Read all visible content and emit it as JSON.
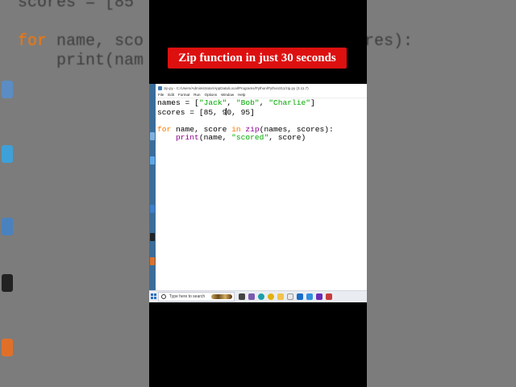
{
  "video": {
    "title": "Zip function in just 30 seconds"
  },
  "background_code": {
    "line1": "scores = [85",
    "line2": "for name, sco",
    "line2b": "ores):",
    "line3": "    print(nam"
  },
  "editor": {
    "window_title": "zip.py - C:/Users/Administrator/AppData/Local/Programs/Python/Python311/zip.py (3.11.7)",
    "menu": [
      "File",
      "Edit",
      "Format",
      "Run",
      "Options",
      "Window",
      "Help"
    ],
    "code_lines": [
      "names = [\"Jack\", \"Bob\", \"Charlie\"]",
      "scores = [85, 90, 95]",
      "",
      "for name, score in zip(names, scores):",
      "    print(name, \"scored\", score)"
    ]
  },
  "taskbar": {
    "search_placeholder": "Type here to search",
    "icons": [
      "task-view",
      "widgets",
      "edge",
      "chrome",
      "file-explorer",
      "store",
      "mail",
      "vs-code",
      "visual-studio",
      "app"
    ]
  },
  "colors": {
    "banner": "#dd1010",
    "keyword": "#ff7700",
    "string": "#00aa00",
    "builtin": "#900090"
  }
}
